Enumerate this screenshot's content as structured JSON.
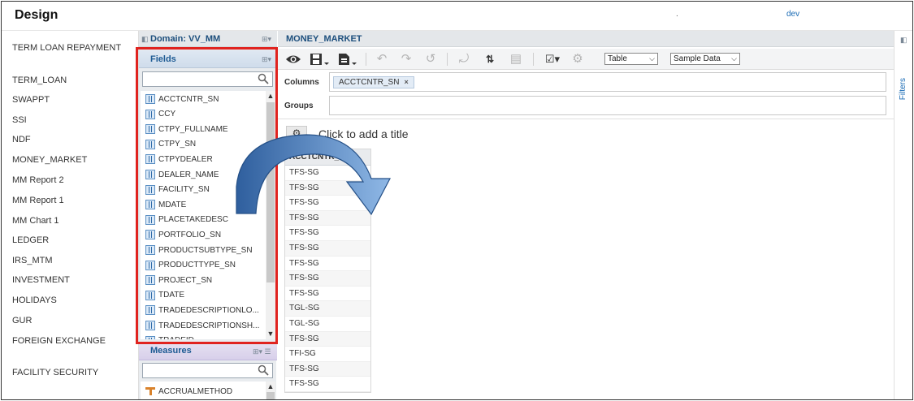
{
  "header": {
    "title": "Design",
    "dot": ".",
    "user": "dev"
  },
  "reports": [
    {
      "label": "TERM LOAN REPAYMENT"
    },
    {
      "label": "TERM_LOAN"
    },
    {
      "label": "SWAPPT"
    },
    {
      "label": "SSI"
    },
    {
      "label": "NDF"
    },
    {
      "label": "MONEY_MARKET"
    },
    {
      "label": "MM Report 2"
    },
    {
      "label": "MM Report 1"
    },
    {
      "label": "MM Chart 1"
    },
    {
      "label": "LEDGER"
    },
    {
      "label": "IRS_MTM"
    },
    {
      "label": "INVESTMENT"
    },
    {
      "label": "HOLIDAYS"
    },
    {
      "label": "GUR"
    },
    {
      "label": "FOREIGN EXCHANGE"
    },
    {
      "label": "FACILITY SECURITY"
    }
  ],
  "domain": {
    "title": "Domain: VV_MM",
    "fields_title": "Fields",
    "fields": [
      "ACCTCNTR_SN",
      "CCY",
      "CTPY_FULLNAME",
      "CTPY_SN",
      "CTPYDEALER",
      "DEALER_NAME",
      "FACILITY_SN",
      "MDATE",
      "PLACETAKEDESC",
      "PORTFOLIO_SN",
      "PRODUCTSUBTYPE_SN",
      "PRODUCTTYPE_SN",
      "PROJECT_SN",
      "TDATE",
      "TRADEDESCRIPTIONLO...",
      "TRADEDESCRIPTIONSH...",
      "TRADEID"
    ],
    "measures_title": "Measures",
    "measures": [
      "ACCRUALMETHOD"
    ]
  },
  "main": {
    "title": "MONEY_MARKET",
    "view_select": "Table",
    "data_select": "Sample Data",
    "columns_label": "Columns",
    "groups_label": "Groups",
    "column_pill": "ACCTCNTR_SN",
    "pill_remove": "×",
    "add_title": "Click to add a title",
    "table_header": "ACCTCNTR_SN",
    "table_rows": [
      "TFS-SG",
      "TFS-SG",
      "TFS-SG",
      "TFS-SG",
      "TFS-SG",
      "TFS-SG",
      "TFS-SG",
      "TFS-SG",
      "TFS-SG",
      "TGL-SG",
      "TGL-SG",
      "TFS-SG",
      "TFI-SG",
      "TFS-SG",
      "TFS-SG"
    ]
  },
  "filters": {
    "label": "Filters"
  },
  "colors": {
    "highlight": "#e0231f",
    "accent": "#1d4f7d",
    "link": "#1a6bb5"
  }
}
